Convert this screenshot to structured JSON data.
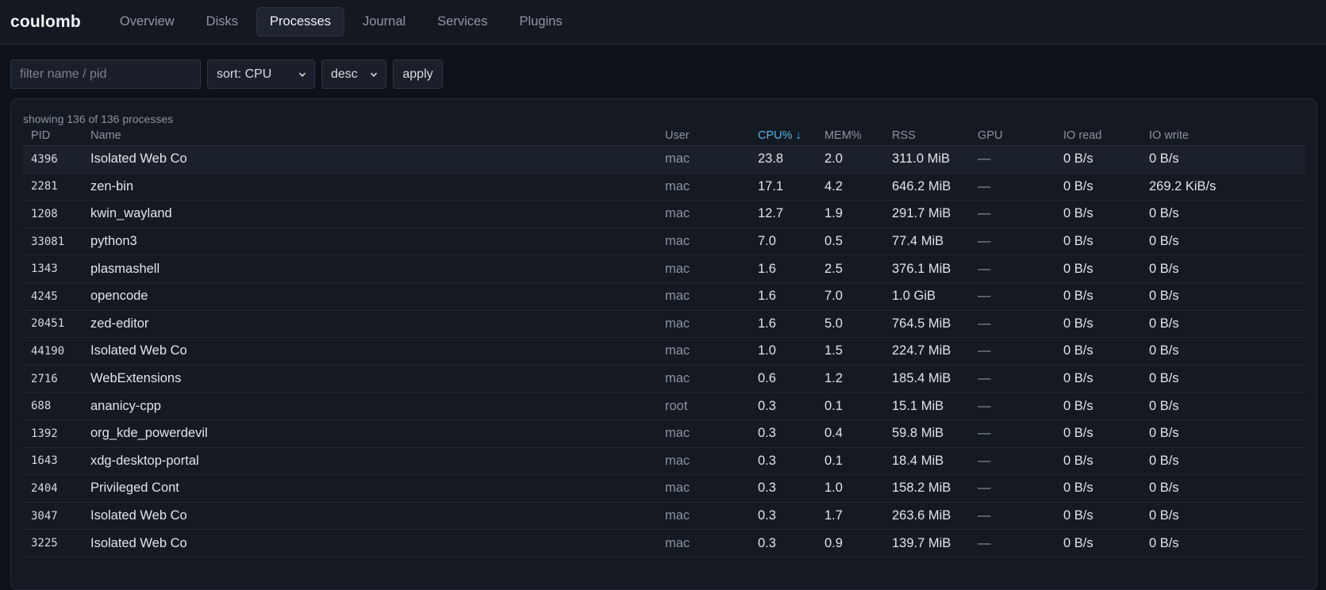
{
  "brand": "coulomb",
  "nav": [
    "Overview",
    "Disks",
    "Processes",
    "Journal",
    "Services",
    "Plugins"
  ],
  "active_tab": "Processes",
  "filters": {
    "placeholder": "filter name / pid",
    "sort": "sort: CPU",
    "direction": "desc",
    "apply": "apply"
  },
  "summary": "showing 136 of 136 processes",
  "columns": [
    "PID",
    "Name",
    "User",
    "CPU% ↓",
    "MEM%",
    "RSS",
    "GPU",
    "IO read",
    "IO write"
  ],
  "sorted_column": "CPU% ↓",
  "rows": [
    {
      "pid": "4396",
      "name": "Isolated Web Co",
      "user": "mac",
      "cpu": "23.8",
      "mem": "2.0",
      "rss": "311.0 MiB",
      "gpu": "—",
      "io_read": "0 B/s",
      "io_write": "0 B/s"
    },
    {
      "pid": "2281",
      "name": "zen-bin",
      "user": "mac",
      "cpu": "17.1",
      "mem": "4.2",
      "rss": "646.2 MiB",
      "gpu": "—",
      "io_read": "0 B/s",
      "io_write": "269.2 KiB/s"
    },
    {
      "pid": "1208",
      "name": "kwin_wayland",
      "user": "mac",
      "cpu": "12.7",
      "mem": "1.9",
      "rss": "291.7 MiB",
      "gpu": "—",
      "io_read": "0 B/s",
      "io_write": "0 B/s"
    },
    {
      "pid": "33081",
      "name": "python3",
      "user": "mac",
      "cpu": "7.0",
      "mem": "0.5",
      "rss": "77.4 MiB",
      "gpu": "—",
      "io_read": "0 B/s",
      "io_write": "0 B/s"
    },
    {
      "pid": "1343",
      "name": "plasmashell",
      "user": "mac",
      "cpu": "1.6",
      "mem": "2.5",
      "rss": "376.1 MiB",
      "gpu": "—",
      "io_read": "0 B/s",
      "io_write": "0 B/s"
    },
    {
      "pid": "4245",
      "name": "opencode",
      "user": "mac",
      "cpu": "1.6",
      "mem": "7.0",
      "rss": "1.0 GiB",
      "gpu": "—",
      "io_read": "0 B/s",
      "io_write": "0 B/s"
    },
    {
      "pid": "20451",
      "name": "zed-editor",
      "user": "mac",
      "cpu": "1.6",
      "mem": "5.0",
      "rss": "764.5 MiB",
      "gpu": "—",
      "io_read": "0 B/s",
      "io_write": "0 B/s"
    },
    {
      "pid": "44190",
      "name": "Isolated Web Co",
      "user": "mac",
      "cpu": "1.0",
      "mem": "1.5",
      "rss": "224.7 MiB",
      "gpu": "—",
      "io_read": "0 B/s",
      "io_write": "0 B/s"
    },
    {
      "pid": "2716",
      "name": "WebExtensions",
      "user": "mac",
      "cpu": "0.6",
      "mem": "1.2",
      "rss": "185.4 MiB",
      "gpu": "—",
      "io_read": "0 B/s",
      "io_write": "0 B/s"
    },
    {
      "pid": "688",
      "name": "ananicy-cpp",
      "user": "root",
      "cpu": "0.3",
      "mem": "0.1",
      "rss": "15.1 MiB",
      "gpu": "—",
      "io_read": "0 B/s",
      "io_write": "0 B/s"
    },
    {
      "pid": "1392",
      "name": "org_kde_powerdevil",
      "user": "mac",
      "cpu": "0.3",
      "mem": "0.4",
      "rss": "59.8 MiB",
      "gpu": "—",
      "io_read": "0 B/s",
      "io_write": "0 B/s"
    },
    {
      "pid": "1643",
      "name": "xdg-desktop-portal",
      "user": "mac",
      "cpu": "0.3",
      "mem": "0.1",
      "rss": "18.4 MiB",
      "gpu": "—",
      "io_read": "0 B/s",
      "io_write": "0 B/s"
    },
    {
      "pid": "2404",
      "name": "Privileged Cont",
      "user": "mac",
      "cpu": "0.3",
      "mem": "1.0",
      "rss": "158.2 MiB",
      "gpu": "—",
      "io_read": "0 B/s",
      "io_write": "0 B/s"
    },
    {
      "pid": "3047",
      "name": "Isolated Web Co",
      "user": "mac",
      "cpu": "0.3",
      "mem": "1.7",
      "rss": "263.6 MiB",
      "gpu": "—",
      "io_read": "0 B/s",
      "io_write": "0 B/s"
    },
    {
      "pid": "3225",
      "name": "Isolated Web Co",
      "user": "mac",
      "cpu": "0.3",
      "mem": "0.9",
      "rss": "139.7 MiB",
      "gpu": "—",
      "io_read": "0 B/s",
      "io_write": "0 B/s"
    }
  ],
  "highlighted_row_pid": "4396",
  "colors": {
    "accent": "#4fb4ea",
    "background": "#0e1218",
    "panel": "#141922",
    "muted_text": "#8a93a1"
  },
  "icons": {
    "select_chevron": "chevron-down-icon"
  }
}
